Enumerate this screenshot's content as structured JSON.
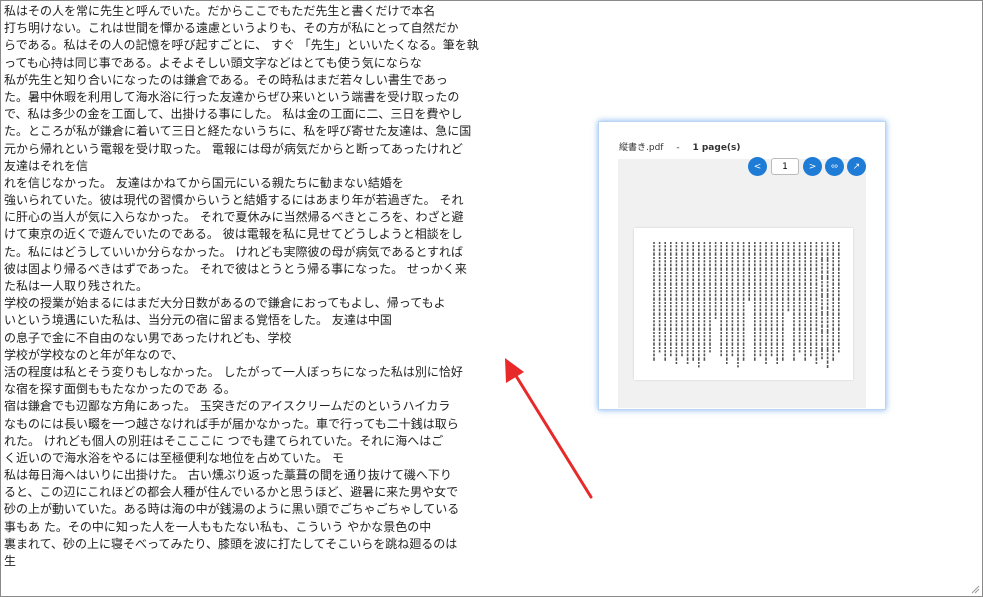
{
  "editor": {
    "lines": [
      "私はその人を常に先生と呼んでいた。だからここでもただ先生と書くだけで本名",
      "打ち明けない。これは世間を憚かる遠慮というよりも、その方が私にとって自然だか",
      "らである。私はその人の記憶を呼び起すごとに、 すぐ 「先生」といいたくなる。筆を執",
      "っても心持は同じ事である。よそよそしい頭文字などはとても使う気にならな",
      "私が先生と知り合いになったのは鎌倉である。その時私はまだ若々しい書生であっ",
      "た。暑中休暇を利用して海水浴に行った友達からぜひ来いという端書を受け取ったの",
      "で、私は多少の金を工面して、出掛ける事にした。 私は金の工面に二、三日を費やし",
      "た。ところが私が鎌倉に着いて三日と経たないうちに、私を呼び寄せた友達は、急に国",
      "元から帰れという電報を受け取った。 電報には母が病気だからと断ってあったけれど",
      "友達はそれを信",
      "れを信じなかった。 友達はかねてから国元にいる親たちに勧まない結婚を",
      "強いられていた。彼は現代の習慣からいうと結婚するにはあまり年が若過ぎた。 それ",
      "に肝心の当人が気に入らなかった。 それで夏休みに当然帰るべきところを、わざと避",
      "けて東京の近くで遊んでいたのである。 彼は電報を私に見せてどうしようと相談をし",
      "た。私にはどうしていいか分らなかった。 けれども実際彼の母が病気であるとすれば",
      "彼は固より帰るべきはずであった。 それで彼はとうとう帰る事になった。 せっかく来",
      "た私は一人取り残された。",
      "学校の授業が始まるにはまだ大分日数があるので鎌倉におってもよし、帰ってもよ",
      "いという境遇にいた私は、当分元の宿に留まる覚悟をした。 友達は中国",
      "の息子で金に不自由のない男であったけれども、学校",
      "学校が学校なのと年が年なので、",
      "活の程度は私とそう変りもしなかった。 したがって一人ぼっちになった私は別に恰好",
      "な宿を探す面倒ももたなかったのであ る。",
      "宿は鎌倉でも辺鄙な方角にあった。 玉突きだのアイスクリームだのというハイカラ",
      "なものには長い畷を一つ越さなければ手が届かなかった。車で行っても二十銭は取ら",
      "れた。 けれども個人の別荘はそこここに つでも建てられていた。それに海へはご",
      "く近いので海水浴をやるには至極便利な地位を占めていた。 モ",
      "私は毎日海へはいりに出掛けた。 古い燻ぶり返った藁葺の間を通り抜けて磯へ下り",
      "ると、この辺にこれほどの都会人種が住んでいるかと思うほど、避暑に来た男や女で",
      "砂の上が動いていた。ある時は海の中が銭湯のように黒い頭でごちゃごちゃしている",
      "事もあ た。その中に知った人を一人ももたない私も、こういう やかな景色の中",
      "裏まれて、砂の上に寝そべってみたり、膝頭を波に打たしてそこいらを跳ね廻るのは",
      "生"
    ]
  },
  "pdf_preview": {
    "file_name": "縦書き.pdf",
    "separator": "-",
    "page_count": "1 page(s)",
    "current_page": "1",
    "buttons": {
      "prev": "<",
      "next": ">",
      "fit": "⬄",
      "open": "↗"
    }
  },
  "colors": {
    "accent": "#1e7bd6",
    "arrow": "#e8292a",
    "popup_glow": "#5aa0ec"
  },
  "icons": {
    "prev": "chevron-left-icon",
    "next": "chevron-right-icon",
    "fit": "fit-width-icon",
    "open": "open-external-icon"
  }
}
